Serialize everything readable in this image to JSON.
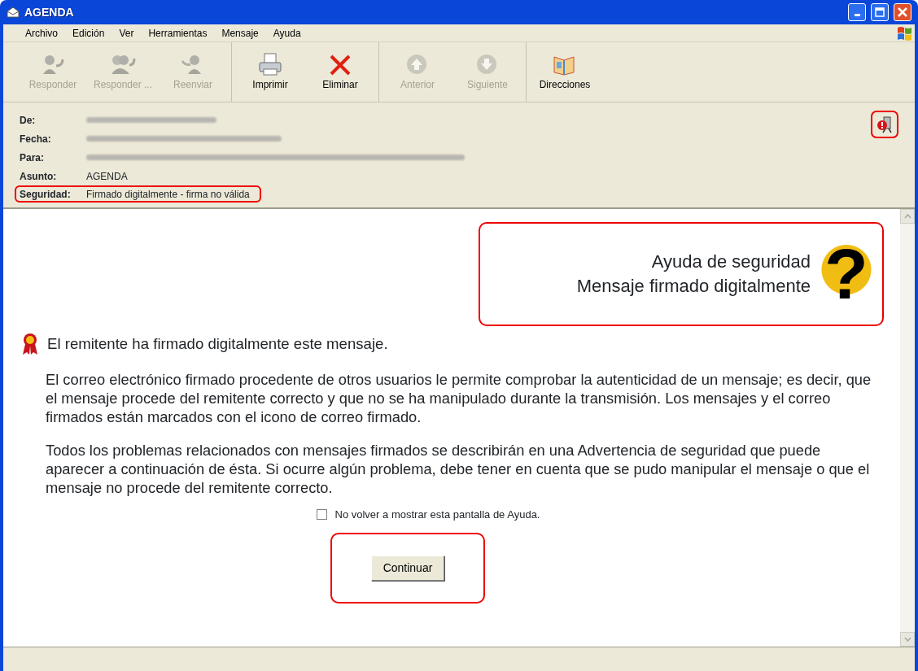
{
  "window": {
    "title": "AGENDA"
  },
  "menu": [
    {
      "label": "Archivo"
    },
    {
      "label": "Edición"
    },
    {
      "label": "Ver"
    },
    {
      "label": "Herramientas"
    },
    {
      "label": "Mensaje"
    },
    {
      "label": "Ayuda"
    }
  ],
  "toolbar_groups": [
    {
      "buttons": [
        {
          "kind": "reply",
          "label": "Responder",
          "disabled": true
        },
        {
          "kind": "reply-all",
          "label": "Responder ...",
          "disabled": true
        },
        {
          "kind": "forward",
          "label": "Reenviar",
          "disabled": true
        }
      ]
    },
    {
      "buttons": [
        {
          "kind": "print",
          "label": "Imprimir",
          "disabled": false
        },
        {
          "kind": "delete",
          "label": "Eliminar",
          "disabled": false
        }
      ]
    },
    {
      "buttons": [
        {
          "kind": "up",
          "label": "Anterior",
          "disabled": true
        },
        {
          "kind": "down",
          "label": "Siguiente",
          "disabled": true
        }
      ]
    },
    {
      "buttons": [
        {
          "kind": "book",
          "label": "Direcciones",
          "disabled": false
        }
      ]
    }
  ],
  "header": {
    "fields": [
      {
        "label": "De:",
        "redacted": true
      },
      {
        "label": "Fecha:",
        "redacted": true
      },
      {
        "label": "Para:",
        "redacted": true
      },
      {
        "label": "Asunto:",
        "value": "AGENDA",
        "redacted": false,
        "highlighted": false
      },
      {
        "label": "Seguridad:",
        "value": "Firmado digitalmente - firma no válida",
        "redacted": false,
        "highlighted": true
      }
    ],
    "security_icon": {
      "highlighted": true
    }
  },
  "help": {
    "title_lines": [
      "Ayuda de seguridad",
      "Mensaje firmado digitalmente"
    ],
    "logo": "?",
    "highlighted": true,
    "intro": "El remitente ha firmado digitalmente este mensaje.",
    "paragraphs": [
      "El correo electrónico firmado procedente de otros usuarios le permite comprobar la autenticidad de un mensaje; es decir, que el mensaje procede del remitente correcto y que no se ha manipulado durante la transmisión. Los mensajes y el correo firmados están marcados con el icono de correo firmado.",
      "Todos los problemas relacionados con mensajes firmados se describirán en una Advertencia de seguridad que puede aparecer a continuación de ésta. Si ocurre algún problema, debe tener en cuenta que se pudo manipular el mensaje o que el mensaje no procede del remitente correcto."
    ],
    "checkbox": {
      "label": "No volver a mostrar esta pantalla de Ayuda.",
      "checked": false
    },
    "button": {
      "label": "Continuar",
      "highlighted": true
    }
  }
}
